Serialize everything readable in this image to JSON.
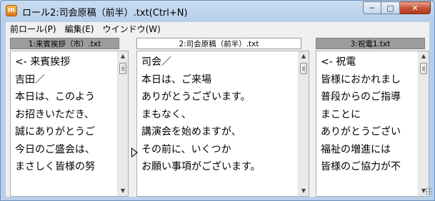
{
  "window": {
    "title": "ロール2:司会原稿（前半）.txt(Ctrl+N)",
    "app_icon_letter": "m",
    "buttons": {
      "minimize": "─",
      "maximize": "□",
      "close": "✕"
    }
  },
  "menu": [
    "前ロール(P)",
    "編集(E)",
    "ウインドウ(W)"
  ],
  "panes": [
    {
      "title": "1:来賓挨拶（市）.txt",
      "lines": [
        "<- 来賓挨拶",
        "吉田／",
        "本日は、このよう",
        "お招きいただき、",
        "誠にありがとうご",
        "今日のご盛会は、",
        "まさしく皆様の努"
      ]
    },
    {
      "title": "2:司会原稿（前半）.txt",
      "lines": [
        "司会／",
        "本日は、ご来場",
        "ありがとうございます。",
        "まもなく、",
        "講演会を始めますが、",
        "その前に、いくつか",
        "お願い事項がございます。"
      ]
    },
    {
      "title": "3:祝電1.txt",
      "lines": [
        "<- 祝電",
        "皆様におかれまし",
        "普段からのご指導",
        "まことに",
        "ありがとうござい",
        "福祉の増進には",
        "皆様のご協力が不"
      ]
    }
  ],
  "icons": {
    "scroll_up": "▲",
    "scroll_down": "▼"
  }
}
